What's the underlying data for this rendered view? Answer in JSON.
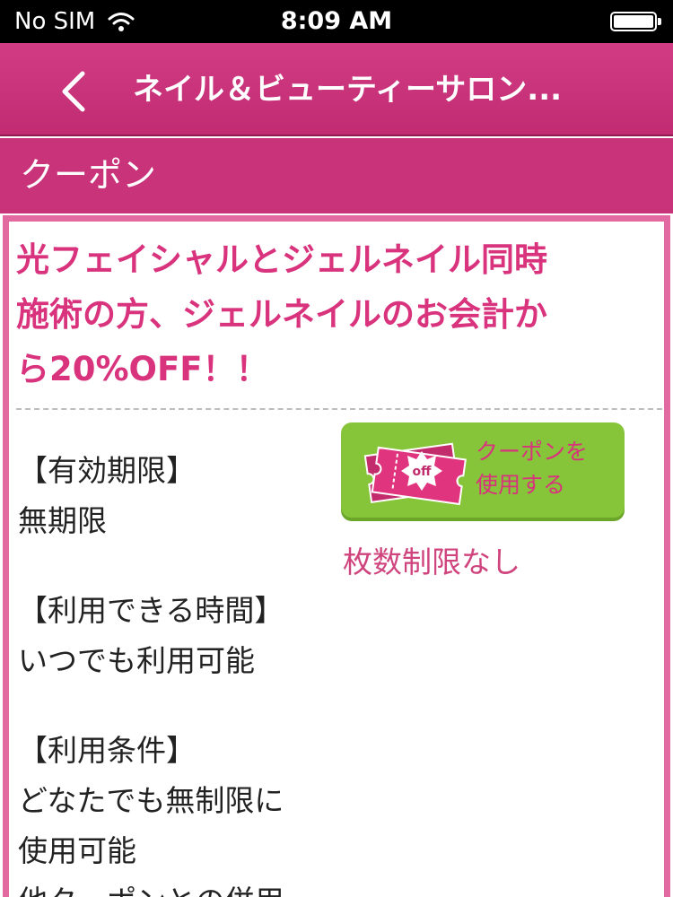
{
  "status_bar": {
    "carrier": "No SIM",
    "time": "8:09 AM",
    "wifi_icon": "wifi-icon",
    "battery_icon": "battery-icon"
  },
  "nav": {
    "back_icon": "chevron-left-icon",
    "title": "ネイル＆ビューティーサロン..."
  },
  "section": {
    "title": "クーポン"
  },
  "coupon": {
    "title_lines": [
      "光フェイシャルとジェルネイル同時",
      "施術の方、ジェルネイルのお会計か",
      "ら20%OFF！！"
    ],
    "details": [
      {
        "label": "【有効期限】",
        "value_lines": [
          "無期限"
        ]
      },
      {
        "label": "【利用できる時間】",
        "value_lines": [
          "いつでも利用可能"
        ]
      },
      {
        "label": "【利用条件】",
        "value_lines": [
          "どなたでも無制限に",
          "使用可能",
          "他クーポンとの併用"
        ]
      }
    ],
    "use_button": {
      "badge": "off",
      "label_lines": [
        "クーポンを",
        "使用する"
      ],
      "icon": "coupon-ticket-icon"
    },
    "limit_note": "枚数制限なし"
  },
  "colors": {
    "nav_bg": "#c93379",
    "card_border": "#e36aa0",
    "accent_text": "#d8337c",
    "button_bg": "#86c53a"
  }
}
